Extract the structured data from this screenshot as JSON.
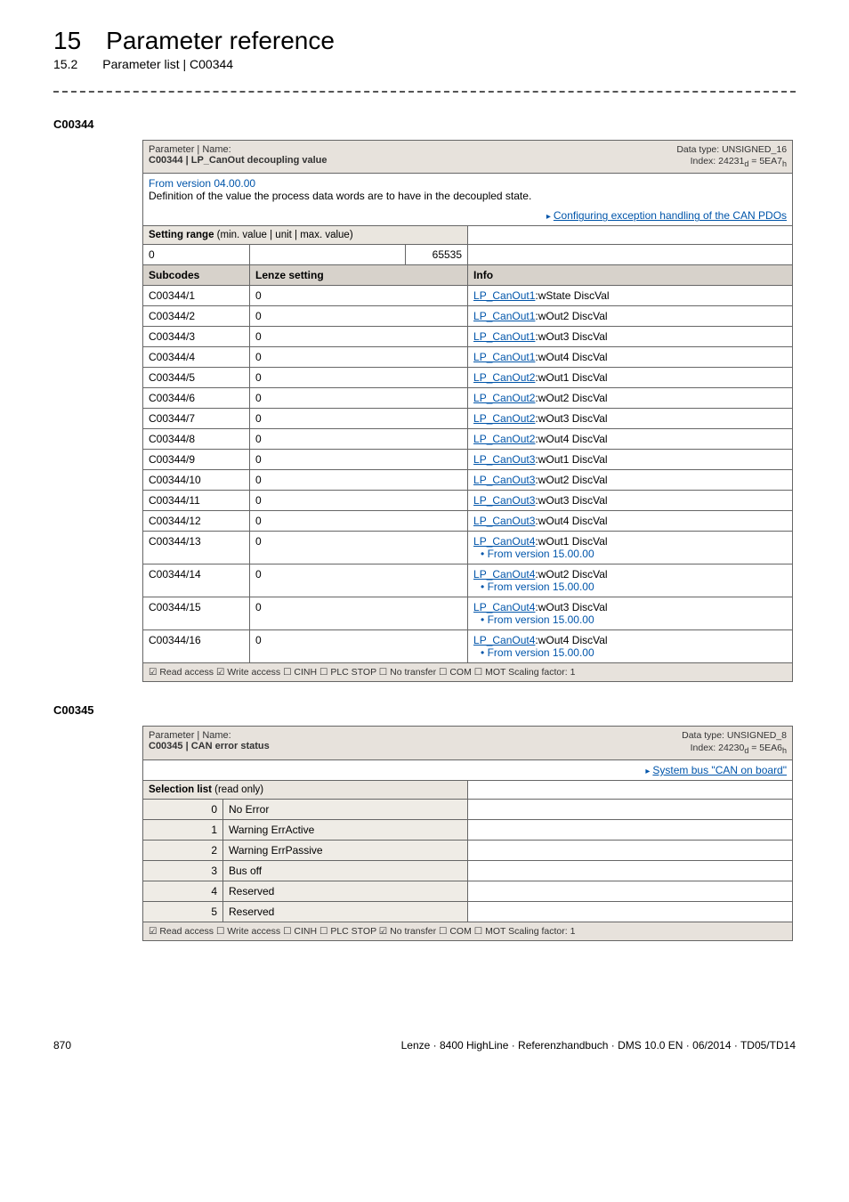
{
  "header": {
    "chapter_num": "15",
    "chapter_title": "Parameter reference",
    "section_num": "15.2",
    "section_title": "Parameter list | C00344"
  },
  "section1": {
    "code": "C00344",
    "param_label": "Parameter | Name:",
    "param_name": "C00344 | LP_CanOut decoupling value",
    "data_type": "Data type: UNSIGNED_16",
    "index": "Index: 24231",
    "index_sub_d": "d",
    "index_eq": " = 5EA7",
    "index_sub_h": "h",
    "from_version": "From version 04.00.00",
    "definition": "Definition of the value the process data words are to have in the decoupled state.",
    "cfg_link": "Configuring exception handling of the CAN PDOs",
    "setting_range_label": "Setting range",
    "setting_range_paren": " (min. value | unit | max. value)",
    "min": "0",
    "max": "65535",
    "subcodes_label": "Subcodes",
    "lenze_label": "Lenze setting",
    "info_label": "Info",
    "rows": [
      {
        "sub": "C00344/1",
        "set": "0",
        "link": "LP_CanOut1",
        "tail": ":wState DiscVal",
        "ver": ""
      },
      {
        "sub": "C00344/2",
        "set": "0",
        "link": "LP_CanOut1",
        "tail": ":wOut2 DiscVal",
        "ver": ""
      },
      {
        "sub": "C00344/3",
        "set": "0",
        "link": "LP_CanOut1",
        "tail": ":wOut3 DiscVal",
        "ver": ""
      },
      {
        "sub": "C00344/4",
        "set": "0",
        "link": "LP_CanOut1",
        "tail": ":wOut4 DiscVal",
        "ver": ""
      },
      {
        "sub": "C00344/5",
        "set": "0",
        "link": "LP_CanOut2",
        "tail": ":wOut1 DiscVal",
        "ver": ""
      },
      {
        "sub": "C00344/6",
        "set": "0",
        "link": "LP_CanOut2",
        "tail": ":wOut2 DiscVal",
        "ver": ""
      },
      {
        "sub": "C00344/7",
        "set": "0",
        "link": "LP_CanOut2",
        "tail": ":wOut3 DiscVal",
        "ver": ""
      },
      {
        "sub": "C00344/8",
        "set": "0",
        "link": "LP_CanOut2",
        "tail": ":wOut4 DiscVal",
        "ver": ""
      },
      {
        "sub": "C00344/9",
        "set": "0",
        "link": "LP_CanOut3",
        "tail": ":wOut1 DiscVal",
        "ver": ""
      },
      {
        "sub": "C00344/10",
        "set": "0",
        "link": "LP_CanOut3",
        "tail": ":wOut2 DiscVal",
        "ver": ""
      },
      {
        "sub": "C00344/11",
        "set": "0",
        "link": "LP_CanOut3",
        "tail": ":wOut3 DiscVal",
        "ver": ""
      },
      {
        "sub": "C00344/12",
        "set": "0",
        "link": "LP_CanOut3",
        "tail": ":wOut4 DiscVal",
        "ver": ""
      },
      {
        "sub": "C00344/13",
        "set": "0",
        "link": "LP_CanOut4",
        "tail": ":wOut1 DiscVal",
        "ver": "From version 15.00.00"
      },
      {
        "sub": "C00344/14",
        "set": "0",
        "link": "LP_CanOut4",
        "tail": ":wOut2 DiscVal",
        "ver": "From version 15.00.00"
      },
      {
        "sub": "C00344/15",
        "set": "0",
        "link": "LP_CanOut4",
        "tail": ":wOut3 DiscVal",
        "ver": "From version 15.00.00"
      },
      {
        "sub": "C00344/16",
        "set": "0",
        "link": "LP_CanOut4",
        "tail": ":wOut4 DiscVal",
        "ver": "From version 15.00.00"
      }
    ],
    "footer": "☑ Read access   ☑ Write access   ☐ CINH   ☐ PLC STOP   ☐ No transfer   ☐ COM   ☐ MOT    Scaling factor: 1"
  },
  "section2": {
    "code": "C00345",
    "param_label": "Parameter | Name:",
    "param_name": "C00345 | CAN error status",
    "data_type": "Data type: UNSIGNED_8",
    "index": "Index: 24230",
    "index_sub_d": "d",
    "index_eq": " = 5EA6",
    "index_sub_h": "h",
    "sys_link": "System bus \"CAN on board\"",
    "sel_list_label": "Selection list",
    "sel_list_paren": " (read only)",
    "rows": [
      {
        "n": "0",
        "v": "No Error"
      },
      {
        "n": "1",
        "v": "Warning ErrActive"
      },
      {
        "n": "2",
        "v": "Warning ErrPassive"
      },
      {
        "n": "3",
        "v": "Bus off"
      },
      {
        "n": "4",
        "v": "Reserved"
      },
      {
        "n": "5",
        "v": "Reserved"
      }
    ],
    "footer": "☑ Read access   ☐ Write access   ☐ CINH   ☐ PLC STOP   ☑ No transfer   ☐ COM   ☐ MOT    Scaling factor: 1"
  },
  "footer": {
    "page": "870",
    "right": "Lenze · 8400 HighLine · Referenzhandbuch · DMS 10.0 EN · 06/2014 · TD05/TD14"
  }
}
